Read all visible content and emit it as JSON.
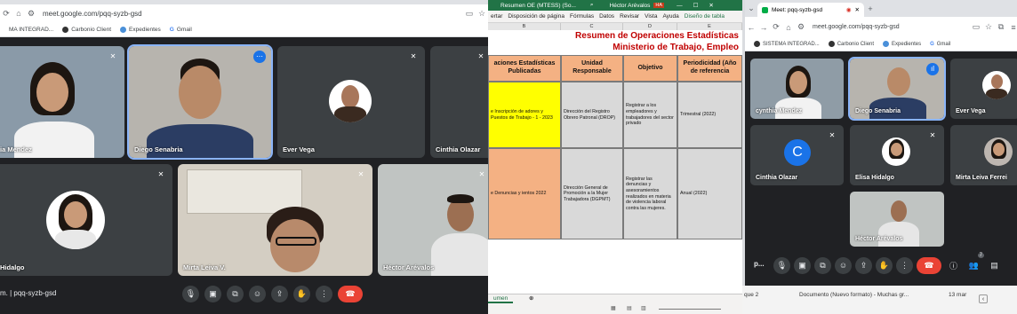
{
  "left_meet": {
    "url": "meet.google.com/pqq-syzb-gsd",
    "bookmarks": [
      "MA INTEGRAD...",
      "Carbonio Client",
      "Expedientes",
      "Gmail"
    ],
    "participants": [
      {
        "name": "ia Mendez"
      },
      {
        "name": "Diego Senabria"
      },
      {
        "name": "Ever Vega"
      },
      {
        "name": "Cinthia Olazar"
      },
      {
        "name": "Hidalgo"
      },
      {
        "name": "Mirta Leiva V."
      },
      {
        "name": "Héctor Arévalos"
      }
    ],
    "meeting_code": "m. | pqq-syzb-gsd"
  },
  "excel": {
    "window_title": "Resumen OE (MTESS) (So...",
    "user": "Héctor Arévalos",
    "user_initials": "HA",
    "ribbon": [
      "ertar",
      "Disposición de página",
      "Fórmulas",
      "Datos",
      "Revisar",
      "Vista",
      "Ayuda",
      "Diseño de tabla"
    ],
    "columns": [
      "B",
      "C",
      "D",
      "E"
    ],
    "title_line1": "Resumen de Operaciones Estadísticas",
    "title_line2": "Ministerio de Trabajo, Empleo",
    "headers": [
      "aciones Estadísticas Publicadas",
      "Unidad Responsable",
      "Objetivo",
      "Periodicidad (Año de referencia"
    ],
    "rows": [
      {
        "operation": "e Inscripción de adores y Puestos de Trabajo - 1 - 2023",
        "unit": "Dirección del Registro Obrero Patronal (DROP)",
        "objective": "Registrar a los empleadores y trabajadores del sector privado",
        "period": "Trimestral (2022)"
      },
      {
        "operation": "e Denuncias y ientos 2022",
        "unit": "Dirección General de Promoción a la Mujer Trabajadora (DGPMT)",
        "objective": "Registrar las denuncias y asesoramientos realizados en materia de violencia laboral contra las mujeres.",
        "period": "Anual (2022)"
      }
    ],
    "sheet_tab": "umen"
  },
  "right_meet": {
    "tab_title": "Meet: pqq-syzb-gsd",
    "url": "meet.google.com/pqq-syzb-gsd",
    "bookmarks": [
      "SISTEMA INTEGRAD...",
      "Carbonio Client",
      "Expedientes",
      "Gmail"
    ],
    "participants": [
      {
        "name": "cynthia Mendez"
      },
      {
        "name": "Diego Senabria"
      },
      {
        "name": "Ever Vega"
      },
      {
        "name": "Cinthia Olazar",
        "initial": "C"
      },
      {
        "name": "Elisa Hidalgo"
      },
      {
        "name": "Mirta Leiva Ferrei"
      },
      {
        "name": "Héctor Arévalos"
      }
    ],
    "meeting_code": "p...",
    "people_count": "7"
  },
  "taskbar": {
    "left_text": "que 2",
    "doc_text": "Documento (Nuevo formato) - Muchas gr...",
    "date_text": "13 mar"
  }
}
